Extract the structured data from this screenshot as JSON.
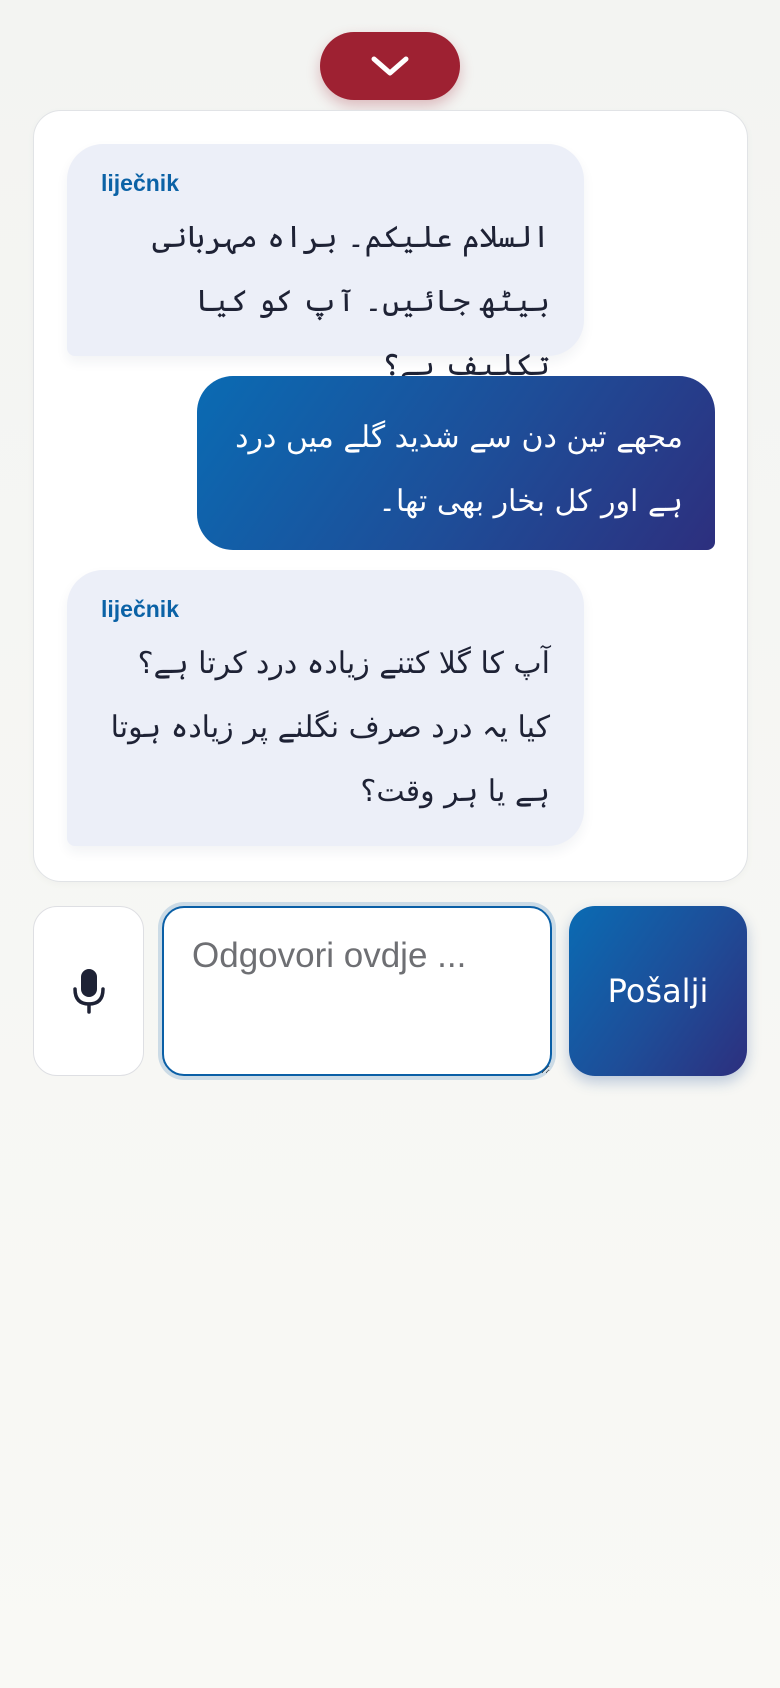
{
  "header": {
    "collapse_icon": "chevron-down-icon",
    "collapse_color": "#9e2132"
  },
  "chat": {
    "messages": [
      {
        "role": "doctor",
        "sender": "liječnik",
        "text": "السلام علیکم۔ براہ مہربانی بیٹھ جائیں۔ آپ کو کیا تکلیف ہے؟"
      },
      {
        "role": "patient",
        "text": "مجھے تین دن سے شدید گلے میں درد ہے اور کل بخار بھی تھا۔"
      },
      {
        "role": "doctor",
        "sender": "liječnik",
        "text": "آپ کا گلا کتنے زیادہ درد کرتا ہے؟ کیا یہ درد صرف نگلنے پر زیادہ ہوتا ہے یا ہر وقت؟"
      }
    ]
  },
  "composer": {
    "mic_icon": "microphone-icon",
    "placeholder": "Odgovori ovdje ...",
    "value": "",
    "send_label": "Pošalji"
  },
  "colors": {
    "accent": "#0a5fa6",
    "doctor_bubble": "#eceff8",
    "doctor_name": "#0b62a6"
  }
}
